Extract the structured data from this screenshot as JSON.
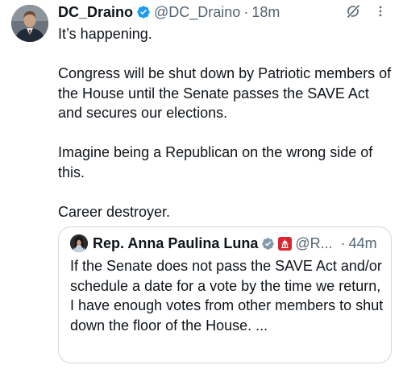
{
  "tweet": {
    "display_name": "DC_Draino",
    "handle": "@DC_Draino",
    "separator": "·",
    "time": "18m",
    "lines": [
      "It’s happening.",
      "",
      "Congress will be shut down by Patriotic members of the House until the Senate passes the SAVE Act and secures our elections.",
      "",
      "Imagine being a Republican on the wrong side of this.",
      "",
      "Career destroyer."
    ],
    "avatar_icon": "user-avatar",
    "verified_icon": "verified-badge-icon",
    "grok_icon": "grok-icon",
    "more_icon": "more-options-icon"
  },
  "quote": {
    "display_name": "Rep. Anna Paulina Luna",
    "handle": "@R...",
    "separator": "·",
    "time": "44m",
    "text": "If the Senate does not pass the SAVE Act and/or schedule a date for a vote by the time we return, I have enough votes from other members to shut down the floor of the House. ...",
    "verified_icon": "verified-badge-gray-icon",
    "affiliation_icon": "government-affiliation-icon"
  },
  "colors": {
    "text_primary": "#0f1419",
    "text_secondary": "#536471",
    "verified_blue": "#1d9bf0",
    "verified_gray": "#829aab",
    "border": "#cfd9de",
    "affiliation_red": "#d6272e"
  }
}
